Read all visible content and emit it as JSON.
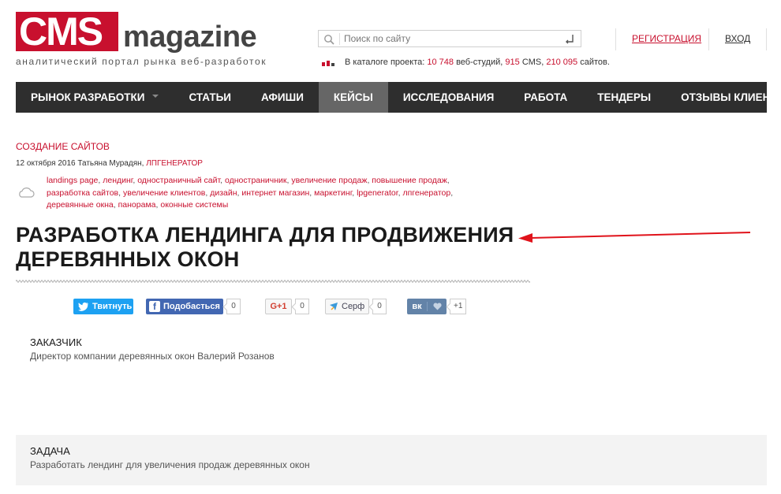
{
  "logo": {
    "brand": "CMS",
    "suffix": "magazine",
    "tagline": "аналитический портал рынка веб-разработок"
  },
  "search": {
    "placeholder": "Поиск по сайту",
    "value": ""
  },
  "catalog": {
    "prefix": "В каталоге проекта:",
    "studios_count": "10 748",
    "studios_label": "веб-студий,",
    "cms_count": "915",
    "cms_label": "CMS,",
    "sites_count": "210 095",
    "sites_label": "сайтов."
  },
  "header": {
    "register_label": "РЕГИСТРАЦИЯ",
    "login_label": "ВХОД"
  },
  "nav": {
    "items": [
      {
        "label": "РЫНОК РАЗРАБОТКИ",
        "has_dropdown": true,
        "active": false
      },
      {
        "label": "СТАТЬИ",
        "active": false
      },
      {
        "label": "АФИШИ",
        "active": false
      },
      {
        "label": "КЕЙСЫ",
        "active": true
      },
      {
        "label": "ИССЛЕДОВАНИЯ",
        "active": false
      },
      {
        "label": "РАБОТА",
        "active": false
      },
      {
        "label": "ТЕНДЕРЫ",
        "active": false
      },
      {
        "label": "ОТЗЫВЫ КЛИЕНТОВ",
        "active": false
      }
    ]
  },
  "article": {
    "rubric": "СОЗДАНИЕ САЙТОВ",
    "date_author": "12 октября 2016 Татьяна Мурадян,",
    "company": "ЛПГЕНЕРАТОР",
    "tags": [
      "landings page",
      "лендинг",
      "одностраничный сайт",
      "одностраничник",
      "увеличение продаж",
      "повышение продаж",
      "разработка сайтов",
      "увеличение клиентов",
      "дизайн",
      "интернет магазин",
      "маркетинг",
      "lpgenerator",
      "лпгенератор",
      "деревянные окна",
      "панорама",
      "оконные системы"
    ],
    "title_line1": "РАЗРАБОТКА ЛЕНДИНГА ДЛЯ ПРОДВИЖЕНИЯ",
    "title_line2": "ДЕРЕВЯННЫХ ОКОН"
  },
  "social": {
    "twitter_label": "Твитнуть",
    "facebook_label": "Подобасться",
    "facebook_count": "0",
    "gplus_label": "G+1",
    "gplus_count": "0",
    "surf_label": "Серф",
    "surf_count": "0",
    "vk_label": "вк",
    "vk_count": "+1"
  },
  "sections": {
    "client_heading": "ЗАКАЗЧИК",
    "client_text": "Директор компании деревянных окон Валерий Розанов",
    "task_heading": "ЗАДАЧА",
    "task_text": "Разработать лендинг для увеличения продаж деревянных окон"
  },
  "colors": {
    "accent": "#c8102e",
    "nav_bg": "#2e2e2e",
    "nav_active": "#666666"
  }
}
